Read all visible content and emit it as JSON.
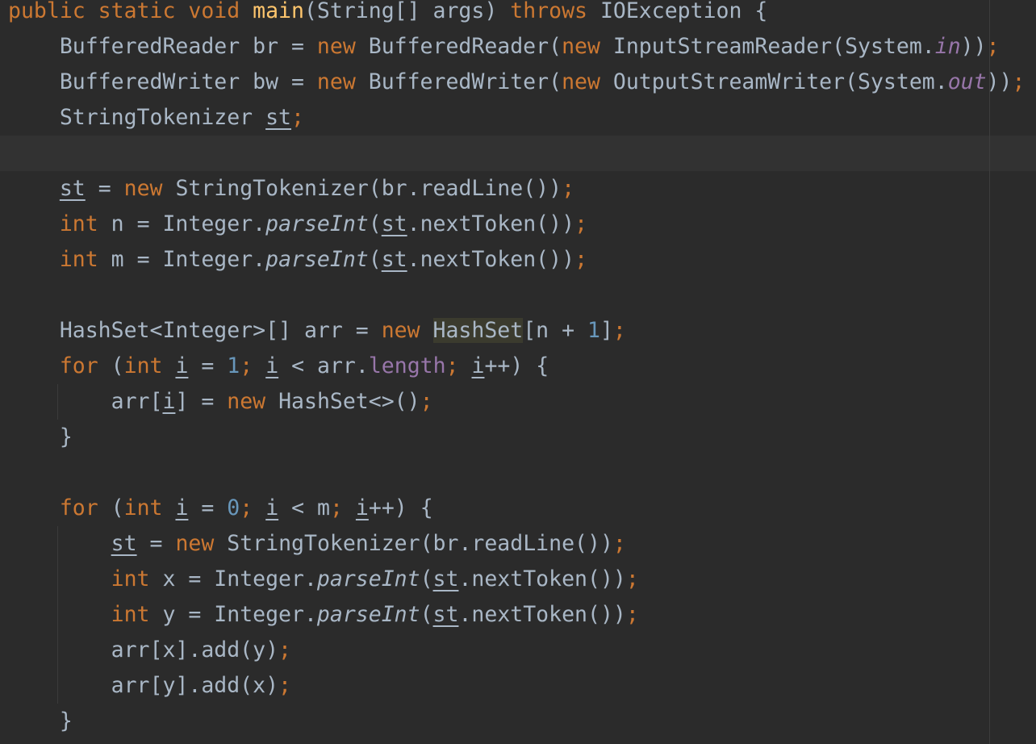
{
  "editor": {
    "language": "Java",
    "theme_colors": {
      "background": "#2b2b2b",
      "current_line": "#323232",
      "keyword": "#cc7832",
      "method_decl": "#ffc66d",
      "number": "#6897bb",
      "field": "#9876aa",
      "default_text": "#a9b7c6",
      "highlight": "#3b3b2e"
    },
    "current_line_index": 4,
    "highlighted_token": "HashSet",
    "lines": [
      [
        {
          "t": "public static void ",
          "c": "kw"
        },
        {
          "t": "main",
          "c": "fn"
        },
        {
          "t": "(String[] args) "
        },
        {
          "t": "throws ",
          "c": "kw"
        },
        {
          "t": "IOException {"
        }
      ],
      [
        {
          "t": "    BufferedReader br = "
        },
        {
          "t": "new ",
          "c": "kw"
        },
        {
          "t": "BufferedReader("
        },
        {
          "t": "new ",
          "c": "kw"
        },
        {
          "t": "InputStreamReader(System."
        },
        {
          "t": "in",
          "c": "sf"
        },
        {
          "t": "))"
        },
        {
          "t": ";",
          "c": "kw"
        }
      ],
      [
        {
          "t": "    BufferedWriter bw = "
        },
        {
          "t": "new ",
          "c": "kw"
        },
        {
          "t": "BufferedWriter("
        },
        {
          "t": "new ",
          "c": "kw"
        },
        {
          "t": "OutputStreamWriter(System."
        },
        {
          "t": "out",
          "c": "sf"
        },
        {
          "t": "))"
        },
        {
          "t": ";",
          "c": "kw"
        }
      ],
      [
        {
          "t": "    StringTokenizer "
        },
        {
          "t": "st",
          "c": "ul"
        },
        {
          "t": ";",
          "c": "kw"
        }
      ],
      [],
      [
        {
          "t": "    "
        },
        {
          "t": "st",
          "c": "ul"
        },
        {
          "t": " = "
        },
        {
          "t": "new ",
          "c": "kw"
        },
        {
          "t": "StringTokenizer(br.readLine())"
        },
        {
          "t": ";",
          "c": "kw"
        }
      ],
      [
        {
          "t": "    "
        },
        {
          "t": "int ",
          "c": "kw"
        },
        {
          "t": "n = Integer."
        },
        {
          "t": "parseInt",
          "c": "st"
        },
        {
          "t": "("
        },
        {
          "t": "st",
          "c": "ul"
        },
        {
          "t": ".nextToken())"
        },
        {
          "t": ";",
          "c": "kw"
        }
      ],
      [
        {
          "t": "    "
        },
        {
          "t": "int ",
          "c": "kw"
        },
        {
          "t": "m = Integer."
        },
        {
          "t": "parseInt",
          "c": "st"
        },
        {
          "t": "("
        },
        {
          "t": "st",
          "c": "ul"
        },
        {
          "t": ".nextToken())"
        },
        {
          "t": ";",
          "c": "kw"
        }
      ],
      [],
      [
        {
          "t": "    HashSet<Integer>[] arr = "
        },
        {
          "t": "new ",
          "c": "kw"
        },
        {
          "t": "HashSet",
          "c": "hl"
        },
        {
          "t": "[n + "
        },
        {
          "t": "1",
          "c": "num"
        },
        {
          "t": "]"
        },
        {
          "t": ";",
          "c": "kw"
        }
      ],
      [
        {
          "t": "    "
        },
        {
          "t": "for ",
          "c": "kw"
        },
        {
          "t": "("
        },
        {
          "t": "int ",
          "c": "kw"
        },
        {
          "t": "i",
          "c": "ul"
        },
        {
          "t": " = "
        },
        {
          "t": "1",
          "c": "num"
        },
        {
          "t": "; ",
          "c": "kw"
        },
        {
          "t": "i",
          "c": "ul"
        },
        {
          "t": " < arr."
        },
        {
          "t": "length",
          "c": "fld"
        },
        {
          "t": "; ",
          "c": "kw"
        },
        {
          "t": "i",
          "c": "ul"
        },
        {
          "t": "++) {"
        }
      ],
      [
        {
          "t": "        arr["
        },
        {
          "t": "i",
          "c": "ul"
        },
        {
          "t": "] = "
        },
        {
          "t": "new ",
          "c": "kw"
        },
        {
          "t": "HashSet<>()"
        },
        {
          "t": ";",
          "c": "kw"
        }
      ],
      [
        {
          "t": "    }"
        }
      ],
      [],
      [
        {
          "t": "    "
        },
        {
          "t": "for ",
          "c": "kw"
        },
        {
          "t": "("
        },
        {
          "t": "int ",
          "c": "kw"
        },
        {
          "t": "i",
          "c": "ul"
        },
        {
          "t": " = "
        },
        {
          "t": "0",
          "c": "num"
        },
        {
          "t": "; ",
          "c": "kw"
        },
        {
          "t": "i",
          "c": "ul"
        },
        {
          "t": " < m"
        },
        {
          "t": "; ",
          "c": "kw"
        },
        {
          "t": "i",
          "c": "ul"
        },
        {
          "t": "++) {"
        }
      ],
      [
        {
          "t": "        "
        },
        {
          "t": "st",
          "c": "ul"
        },
        {
          "t": " = "
        },
        {
          "t": "new ",
          "c": "kw"
        },
        {
          "t": "StringTokenizer(br.readLine())"
        },
        {
          "t": ";",
          "c": "kw"
        }
      ],
      [
        {
          "t": "        "
        },
        {
          "t": "int ",
          "c": "kw"
        },
        {
          "t": "x = Integer."
        },
        {
          "t": "parseInt",
          "c": "st"
        },
        {
          "t": "("
        },
        {
          "t": "st",
          "c": "ul"
        },
        {
          "t": ".nextToken())"
        },
        {
          "t": ";",
          "c": "kw"
        }
      ],
      [
        {
          "t": "        "
        },
        {
          "t": "int ",
          "c": "kw"
        },
        {
          "t": "y = Integer."
        },
        {
          "t": "parseInt",
          "c": "st"
        },
        {
          "t": "("
        },
        {
          "t": "st",
          "c": "ul"
        },
        {
          "t": ".nextToken())"
        },
        {
          "t": ";",
          "c": "kw"
        }
      ],
      [
        {
          "t": "        arr[x].add(y)"
        },
        {
          "t": ";",
          "c": "kw"
        }
      ],
      [
        {
          "t": "        arr[y].add(x)"
        },
        {
          "t": ";",
          "c": "kw"
        }
      ],
      [
        {
          "t": "    }"
        }
      ]
    ]
  }
}
